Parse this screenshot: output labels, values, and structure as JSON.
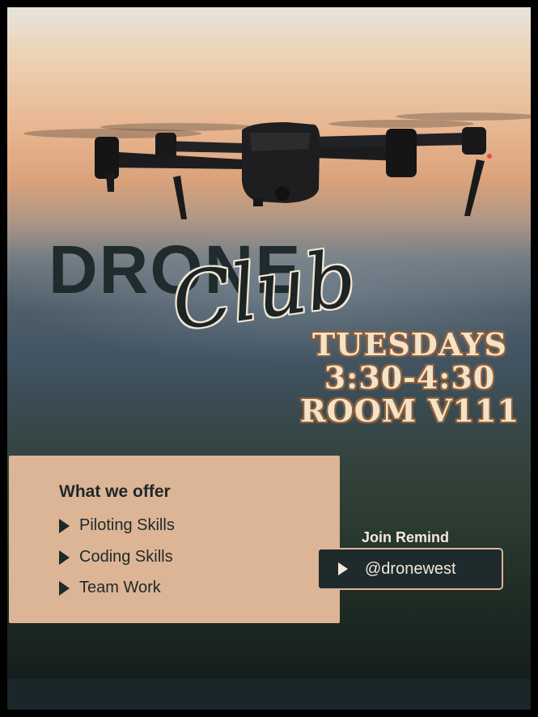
{
  "poster": {
    "title_primary": "DRONE",
    "title_script": "Club",
    "schedule": [
      "TUESDAYS",
      "3:30-4:30",
      "ROOM V111"
    ],
    "offer": {
      "heading": "What we offer",
      "items": [
        "Piloting Skills",
        "Coding Skills",
        "Team Work"
      ],
      "bullet_icon": "chevron-right-icon"
    },
    "join": {
      "label": "Join Remind",
      "handle": "@dronewest",
      "icon": "chevron-right-icon"
    },
    "colors": {
      "card_tan": "#dcb596",
      "dark_teal": "#1f2a2d",
      "cream_text": "#f3e3c8",
      "schedule_outline": "#8c5f3b"
    }
  }
}
